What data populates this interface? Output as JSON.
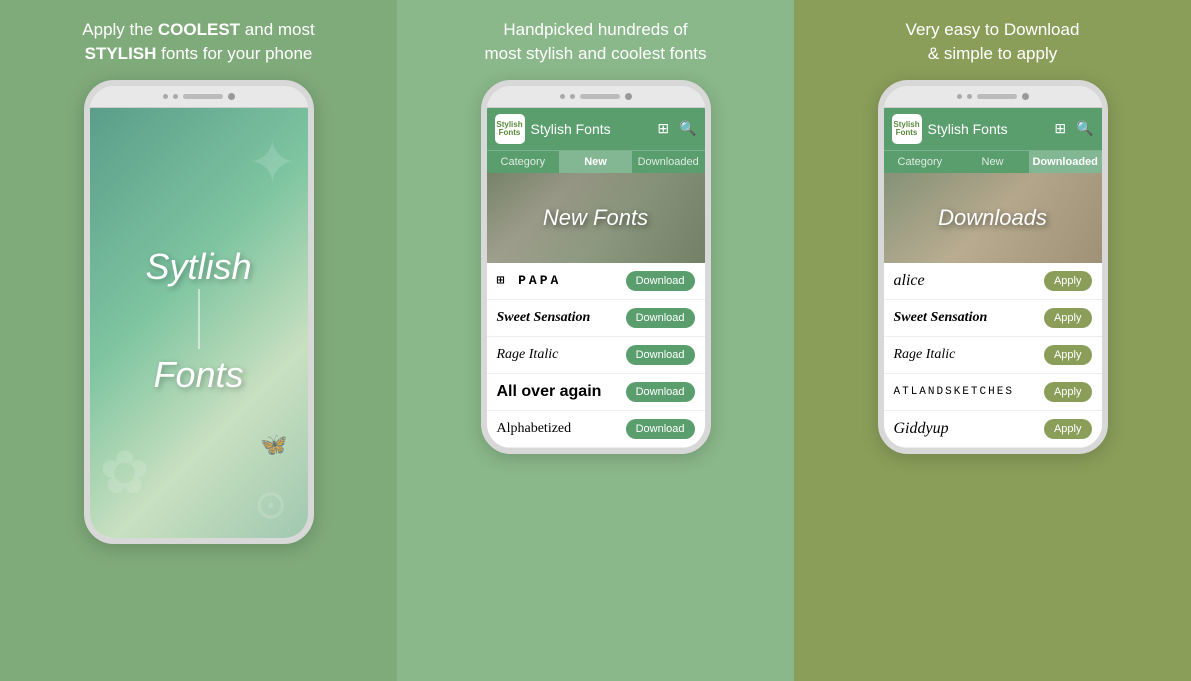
{
  "panels": [
    {
      "id": "panel-1",
      "tagline": "Apply the COOLEST and most STYLISH fonts for your phone",
      "screen_type": "splash",
      "splash": {
        "title_line1": "Sytlish",
        "title_line2": "Fonts"
      }
    },
    {
      "id": "panel-2",
      "tagline": "Handpicked hundreds of most stylish and coolest fonts",
      "screen_type": "app",
      "app": {
        "logo_text": "Stylish\nFonts",
        "header_title": "Stylish Fonts",
        "tabs": [
          "Category",
          "New",
          "Downloaded"
        ],
        "active_tab": 1,
        "banner_text": "New Fonts",
        "fonts": [
          {
            "name": "⊞ PAPA",
            "style": "font-name-1",
            "action": "Download"
          },
          {
            "name": "Sweet Sensation",
            "style": "font-name-2",
            "action": "Download"
          },
          {
            "name": "Rage Italic",
            "style": "font-name-3",
            "action": "Download"
          },
          {
            "name": "All over again",
            "style": "font-name-4",
            "action": "Download"
          },
          {
            "name": "Alphabetized",
            "style": "font-name-5",
            "action": "Download"
          }
        ]
      }
    },
    {
      "id": "panel-3",
      "tagline": "Very easy to Download & simple to apply",
      "screen_type": "app",
      "app": {
        "logo_text": "Stylish\nFonts",
        "header_title": "Stylish Fonts",
        "tabs": [
          "Category",
          "New",
          "Downloaded"
        ],
        "active_tab": 2,
        "banner_text": "Downloads",
        "fonts": [
          {
            "name": "alice",
            "style": "font-name-alice",
            "action": "Apply"
          },
          {
            "name": "Sweet Sensation",
            "style": "font-name-sweet",
            "action": "Apply"
          },
          {
            "name": "Rage Italic",
            "style": "font-name-rage",
            "action": "Apply"
          },
          {
            "name": "ATLANDSKETCHES",
            "style": "font-name-atlas",
            "action": "Apply"
          },
          {
            "name": "Giddyup",
            "style": "font-name-giddy",
            "action": "Apply"
          }
        ]
      }
    }
  ],
  "buttons": {
    "download_label": "Download",
    "apply_label": "Apply"
  }
}
